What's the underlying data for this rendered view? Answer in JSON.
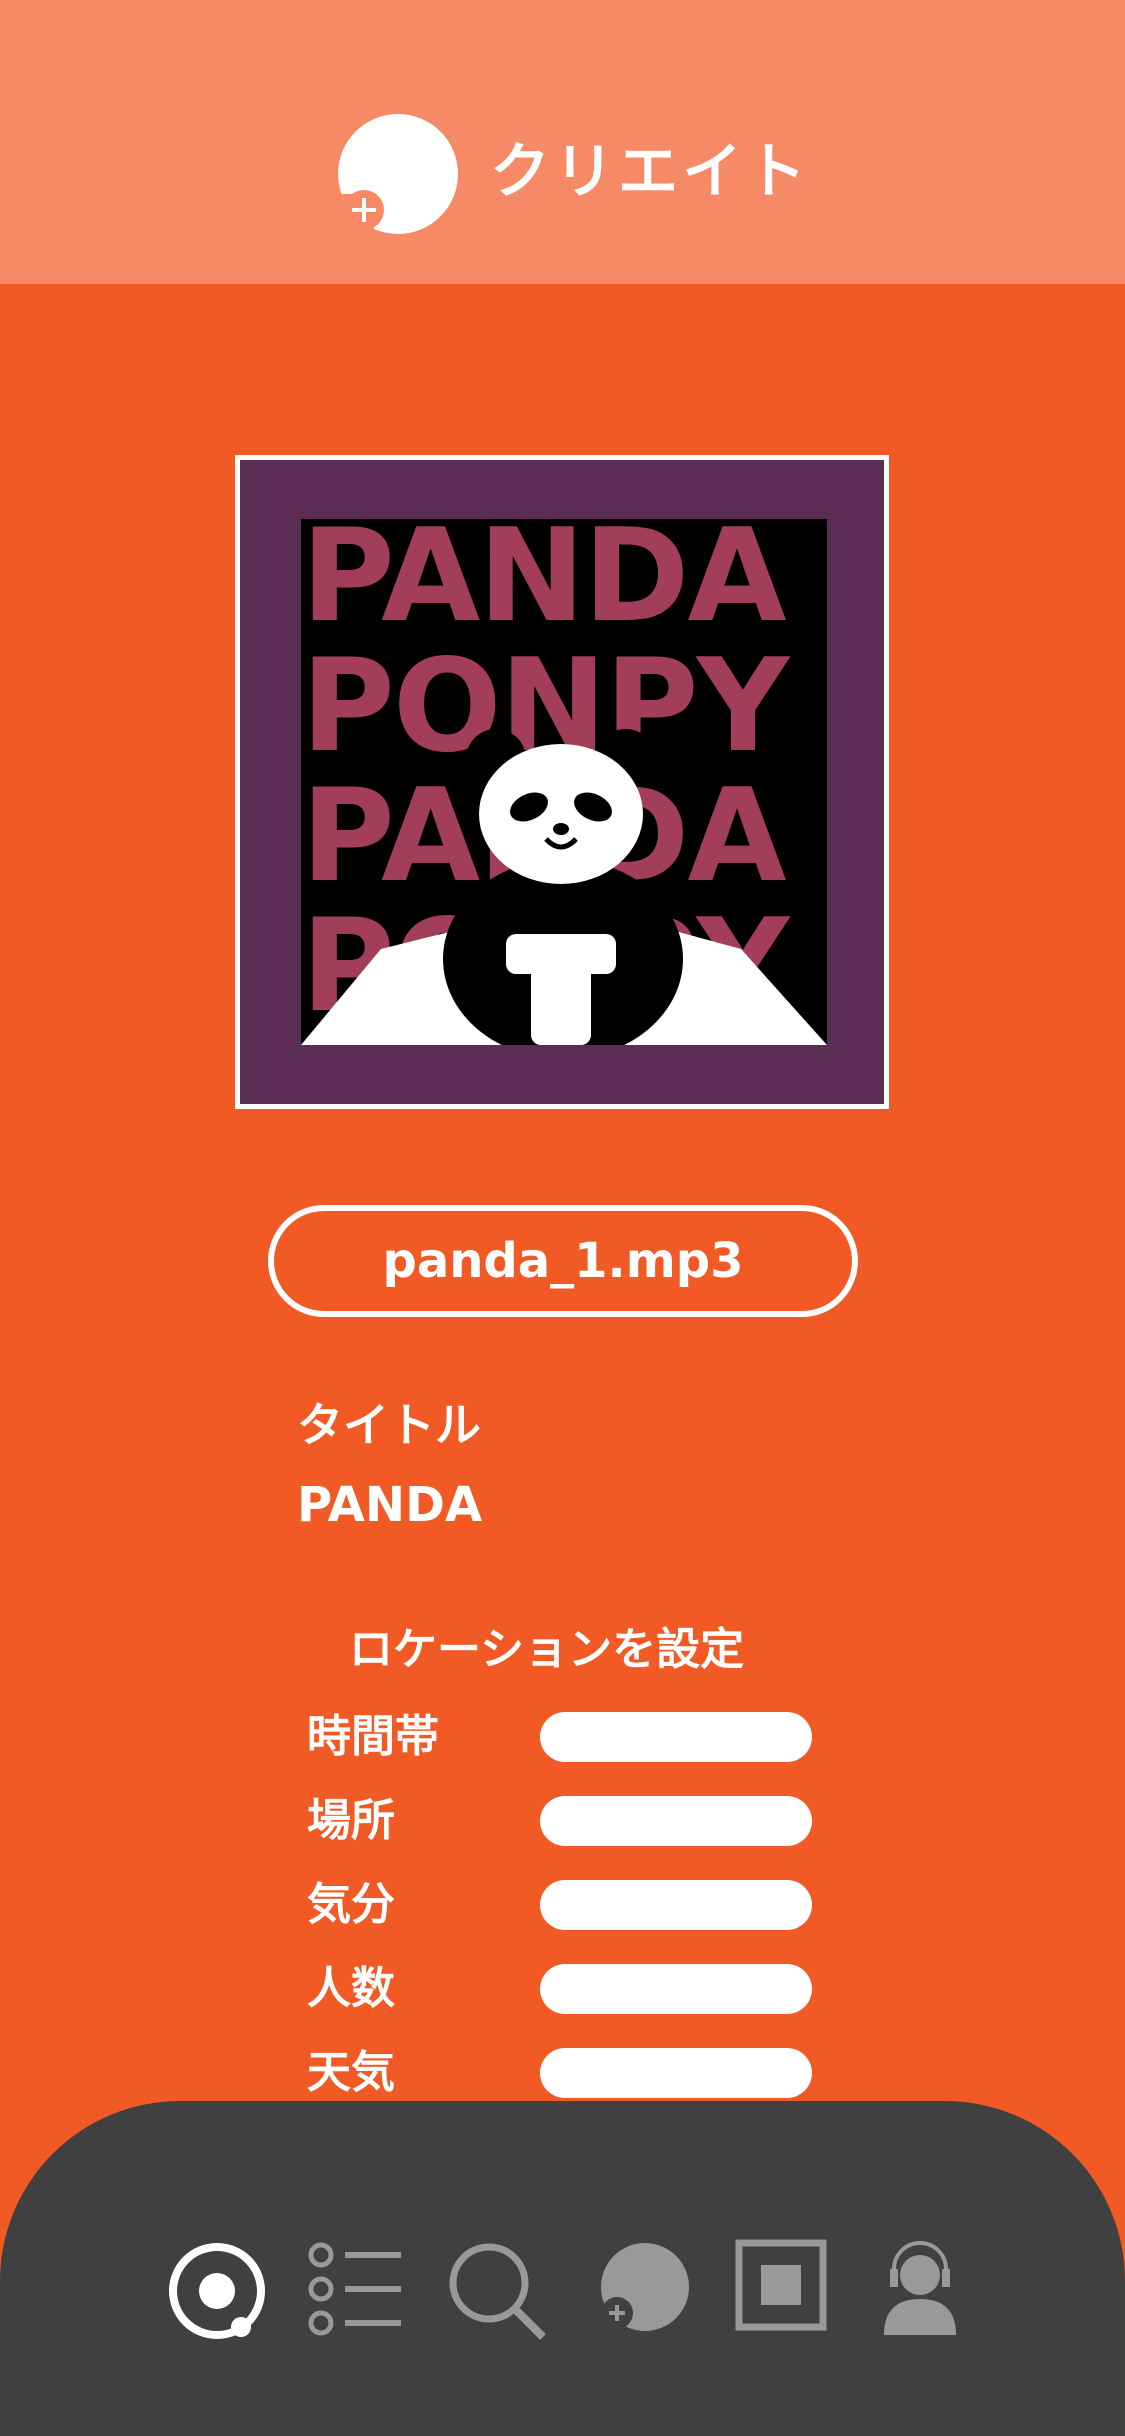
{
  "header": {
    "title": "クリエイト",
    "logo_icon": "create-plus-icon",
    "background": "#f78a66"
  },
  "theme": {
    "accent": "#f15a24",
    "nav_background": "#404040"
  },
  "artwork": {
    "lines": [
      "PANDA",
      "PONPY",
      "PANDA",
      "PONPY"
    ]
  },
  "file": {
    "name": "panda_1.mp3"
  },
  "track": {
    "title_label": "タイトル",
    "title_value": "PANDA"
  },
  "location": {
    "heading": "ロケーションを設定",
    "fields": [
      {
        "label": "時間帯",
        "value": ""
      },
      {
        "label": "場所",
        "value": ""
      },
      {
        "label": "気分",
        "value": ""
      },
      {
        "label": "人数",
        "value": ""
      },
      {
        "label": "天気",
        "value": ""
      }
    ]
  },
  "nav": {
    "items": [
      {
        "icon": "radar-icon",
        "active": true
      },
      {
        "icon": "list-icon",
        "active": false
      },
      {
        "icon": "search-icon",
        "active": false
      },
      {
        "icon": "create-plus-icon",
        "active": false
      },
      {
        "icon": "square-stop-icon",
        "active": false
      },
      {
        "icon": "user-headset-icon",
        "active": false
      }
    ]
  }
}
